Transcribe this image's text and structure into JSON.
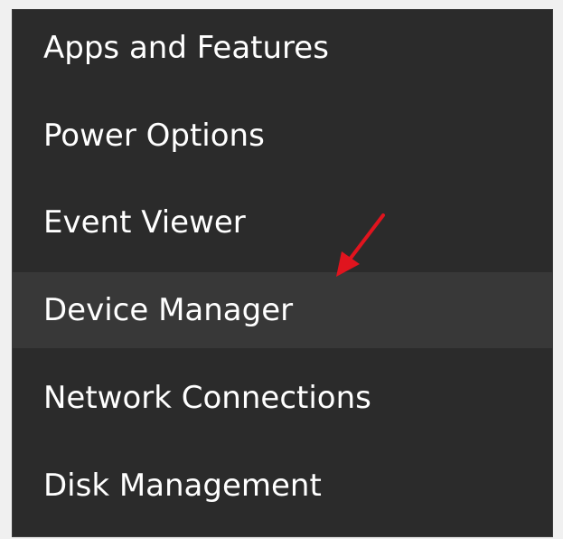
{
  "menu": {
    "items": [
      {
        "label": "Apps and Features"
      },
      {
        "label": "Power Options"
      },
      {
        "label": "Event Viewer"
      },
      {
        "label": "Device Manager",
        "highlighted": true
      },
      {
        "label": "Network Connections"
      },
      {
        "label": "Disk Management"
      }
    ]
  },
  "annotation": {
    "icon": "red-arrow-icon",
    "color": "#e0141e"
  },
  "colors": {
    "menu_background": "#2b2b2b",
    "highlight_background": "#383838",
    "text": "#ffffff"
  }
}
